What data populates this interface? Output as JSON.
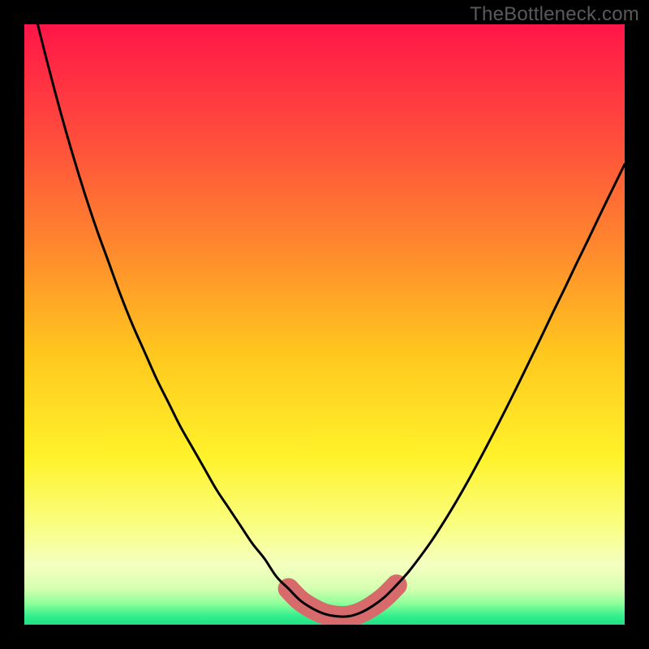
{
  "watermark": "TheBottleneck.com",
  "colors": {
    "frame_bg": "#000000",
    "curve_stroke": "#000000",
    "marker_fill": "#d76a6a",
    "marker_stroke": "#c95f5f",
    "gradient_stops": [
      {
        "offset": 0.0,
        "color": "#ff1648"
      },
      {
        "offset": 0.18,
        "color": "#ff4a3d"
      },
      {
        "offset": 0.38,
        "color": "#ff8b2d"
      },
      {
        "offset": 0.55,
        "color": "#ffc81e"
      },
      {
        "offset": 0.72,
        "color": "#fff22a"
      },
      {
        "offset": 0.84,
        "color": "#f9ff86"
      },
      {
        "offset": 0.9,
        "color": "#f5ffc0"
      },
      {
        "offset": 0.94,
        "color": "#d6ffb0"
      },
      {
        "offset": 0.965,
        "color": "#8dff9a"
      },
      {
        "offset": 0.985,
        "color": "#35ef8d"
      },
      {
        "offset": 1.0,
        "color": "#1fe183"
      }
    ]
  },
  "chart_data": {
    "type": "line",
    "title": "",
    "xlabel": "",
    "ylabel": "",
    "xlim": [
      0,
      100
    ],
    "ylim": [
      0,
      100
    ],
    "x": [
      0,
      2,
      4,
      6,
      8,
      10,
      12,
      14,
      16,
      18,
      20,
      22,
      24,
      26,
      28,
      30,
      32,
      34,
      36,
      38,
      40,
      42,
      44,
      46,
      48,
      50,
      52,
      54,
      56,
      58,
      60,
      62,
      64,
      66,
      68,
      70,
      72,
      74,
      76,
      78,
      80,
      82,
      84,
      86,
      88,
      90,
      92,
      94,
      96,
      98,
      100
    ],
    "series": [
      {
        "name": "bottleneck-curve",
        "values": [
          110,
          101,
          93,
          85.5,
          78.5,
          72,
          66,
          60.5,
          55,
          50,
          45.5,
          41,
          37,
          33,
          29.5,
          26,
          22.5,
          19.5,
          16.5,
          13.5,
          11,
          8,
          6,
          4,
          2.7,
          1.8,
          1.4,
          1.4,
          2.0,
          3.1,
          4.6,
          6.6,
          8.8,
          11.4,
          14.2,
          17.3,
          20.6,
          24.1,
          27.8,
          31.6,
          35.5,
          39.5,
          43.6,
          47.7,
          51.9,
          56.0,
          60.2,
          64.3,
          68.5,
          72.6,
          76.7
        ]
      }
    ],
    "annotations": {
      "marker_band": {
        "x_range": [
          45,
          61
        ],
        "note": "thick rounded highlight along curve bottom"
      }
    }
  }
}
